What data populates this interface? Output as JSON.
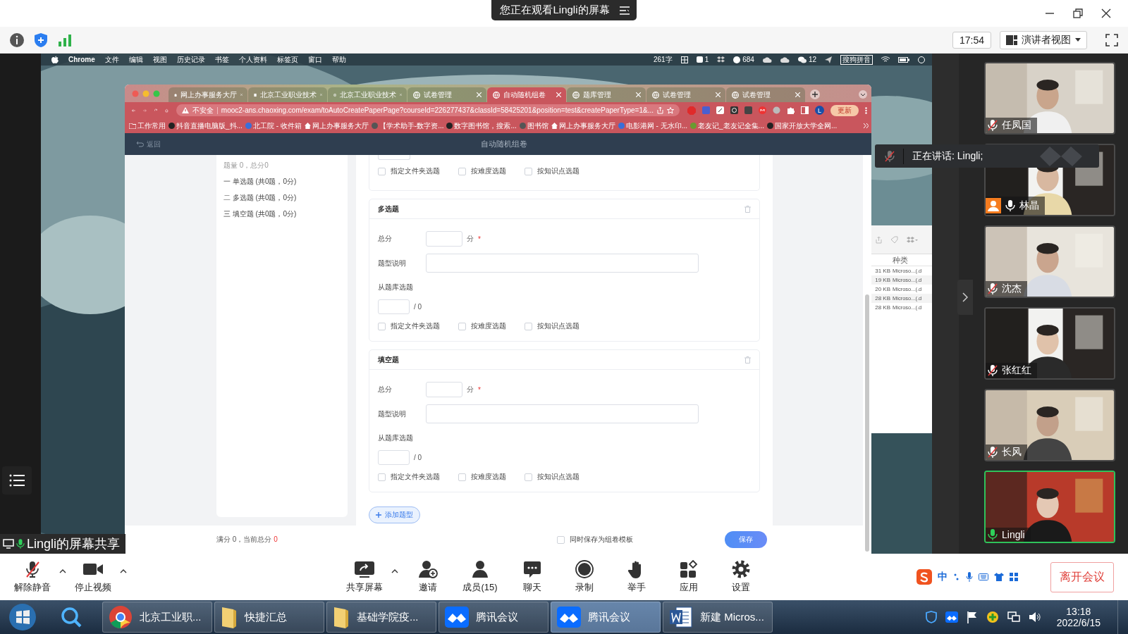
{
  "meeting_bar": {
    "title": "您正在观看Lingli的屏幕"
  },
  "info_bar": {
    "time": "17:54",
    "view": "演讲者视图"
  },
  "mac_menu": {
    "items": [
      "Chrome",
      "文件",
      "编辑",
      "视图",
      "历史记录",
      "书签",
      "个人资料",
      "标签页",
      "窗口",
      "帮助"
    ],
    "status": [
      "261字",
      "1",
      "684",
      "12",
      "搜狗拼音"
    ]
  },
  "browser": {
    "tabs": [
      {
        "kind": "home",
        "label": "网上办事服务大厅",
        "selected": false
      },
      {
        "kind": "page",
        "label": "北京工业职业技术",
        "selected": false
      },
      {
        "kind": "globe",
        "label": "北京工业职业技术",
        "selected": false
      },
      {
        "kind": "globe",
        "label": "试卷管理",
        "selected": false
      },
      {
        "kind": "globe",
        "label": "自动随机组卷",
        "selected": true
      },
      {
        "kind": "globe",
        "label": "题库管理",
        "selected": false
      },
      {
        "kind": "globe",
        "label": "试卷管理",
        "selected": false
      },
      {
        "kind": "globe",
        "label": "试卷管理",
        "selected": false
      }
    ],
    "security": "不安全",
    "url": "mooc2-ans.chaoxing.com/exam/toAutoCreatePaperPage?courseId=226277437&classId=58425201&position=test&createPaperType=1&...",
    "update": "更新",
    "profile": "L",
    "bookmarks": [
      {
        "kind": "folder",
        "label": "工作常用"
      },
      {
        "kind": "dark",
        "label": "抖音直播电脑版_抖..."
      },
      {
        "kind": "blue",
        "label": "北工院 - 收件箱"
      },
      {
        "kind": "home",
        "label": "网上办事服务大厅"
      },
      {
        "kind": "globe",
        "label": "【学术助手-数字资..."
      },
      {
        "kind": "dark",
        "label": "数字图书馆，搜索..."
      },
      {
        "kind": "globe",
        "label": "图书馆"
      },
      {
        "kind": "home",
        "label": "网上办事服务大厅"
      },
      {
        "kind": "blue",
        "label": "电影港网 - 无水印..."
      },
      {
        "kind": "green",
        "label": "老友记_老友记全集..."
      },
      {
        "kind": "dark",
        "label": "国家开放大学全网..."
      }
    ]
  },
  "page": {
    "back": "返回",
    "title": "自动随机组卷",
    "summary": "题量 0，总分0",
    "outline": [
      "一 单选题 (共0题，0分)",
      "二 多选题 (共0题，0分)",
      "三 填空题 (共0题，0分)"
    ],
    "partial_checkboxes": [
      {
        "label": "指定文件夹选题",
        "checked": false
      },
      {
        "label": "按难度选题",
        "checked": false
      },
      {
        "label": "按知识点选题",
        "checked": false
      }
    ],
    "sections": [
      {
        "title": "多选题",
        "score_label": "总分",
        "score_unit": "分",
        "required": "*",
        "desc_label": "题型说明",
        "bank_label": "从题库选题",
        "bank_total": "/ 0",
        "checkboxes": [
          {
            "label": "指定文件夹选题",
            "checked": false
          },
          {
            "label": "按难度选题",
            "checked": false
          },
          {
            "label": "按知识点选题",
            "checked": false
          }
        ]
      },
      {
        "title": "填空题",
        "score_label": "总分",
        "score_unit": "分",
        "required": "*",
        "desc_label": "题型说明",
        "bank_label": "从题库选题",
        "bank_total": "/ 0",
        "checkboxes": [
          {
            "label": "指定文件夹选题",
            "checked": false
          },
          {
            "label": "按难度选题",
            "checked": false
          },
          {
            "label": "按知识点选题",
            "checked": false
          }
        ]
      }
    ],
    "add_button": "添加题型",
    "footer": {
      "total": "满分 0，当前总分",
      "current": "0",
      "template": {
        "label": "同时保存为组卷模板",
        "checked": false
      },
      "save": "保存"
    }
  },
  "finder": {
    "column": "种类",
    "rows": [
      {
        "size": "31 KB",
        "kind": "Microso...(.d"
      },
      {
        "size": "19 KB",
        "kind": "Microso...(.d"
      },
      {
        "size": "20 KB",
        "kind": "Microso...(.d"
      },
      {
        "size": "28 KB",
        "kind": "Microso...(.d"
      },
      {
        "size": "28 KB",
        "kind": "Microso...(.d"
      }
    ]
  },
  "share_label": "Lingli的屏幕共享",
  "speaking": "正在讲话: Lingli;",
  "participants": [
    {
      "name": "任凤国",
      "muted": true,
      "avatar_badge": false,
      "selected": false
    },
    {
      "name": "林晶",
      "muted": false,
      "avatar_badge": true,
      "selected": false
    },
    {
      "name": "沈杰",
      "muted": true,
      "avatar_badge": false,
      "selected": false
    },
    {
      "name": "张红红",
      "muted": true,
      "avatar_badge": false,
      "selected": false
    },
    {
      "name": "长风",
      "muted": true,
      "avatar_badge": false,
      "selected": false
    },
    {
      "name": "Lingli",
      "muted": false,
      "avatar_badge": false,
      "selected": true
    }
  ],
  "toolbar": {
    "left": [
      {
        "kind": "mic",
        "label": "解除静音",
        "caret": true
      },
      {
        "kind": "video",
        "label": "停止视频",
        "caret": true
      }
    ],
    "center": [
      {
        "kind": "share",
        "label": "共享屏幕",
        "caret": true
      },
      {
        "kind": "invite",
        "label": "邀请",
        "caret": false
      },
      {
        "kind": "members",
        "label": "成员(15)",
        "caret": false
      },
      {
        "kind": "chat",
        "label": "聊天",
        "caret": false
      },
      {
        "kind": "record",
        "label": "录制",
        "caret": false
      },
      {
        "kind": "hand",
        "label": "举手",
        "caret": false
      },
      {
        "kind": "apps",
        "label": "应用",
        "caret": false
      },
      {
        "kind": "settings",
        "label": "设置",
        "caret": false
      }
    ],
    "ime": "中",
    "leave": "离开会议"
  },
  "taskbar": {
    "items": [
      {
        "kind": "chrome",
        "label": "北京工业职...",
        "selected": false
      },
      {
        "kind": "folder",
        "label": "快捷汇总",
        "selected": false
      },
      {
        "kind": "folder",
        "label": "基础学院疫...",
        "selected": false
      },
      {
        "kind": "meeting",
        "label": "腾讯会议",
        "selected": false
      },
      {
        "kind": "meeting",
        "label": "腾讯会议",
        "selected": true
      },
      {
        "kind": "word",
        "label": "新建 Micros...",
        "selected": false
      }
    ],
    "time": "13:18",
    "date": "2022/6/15"
  }
}
